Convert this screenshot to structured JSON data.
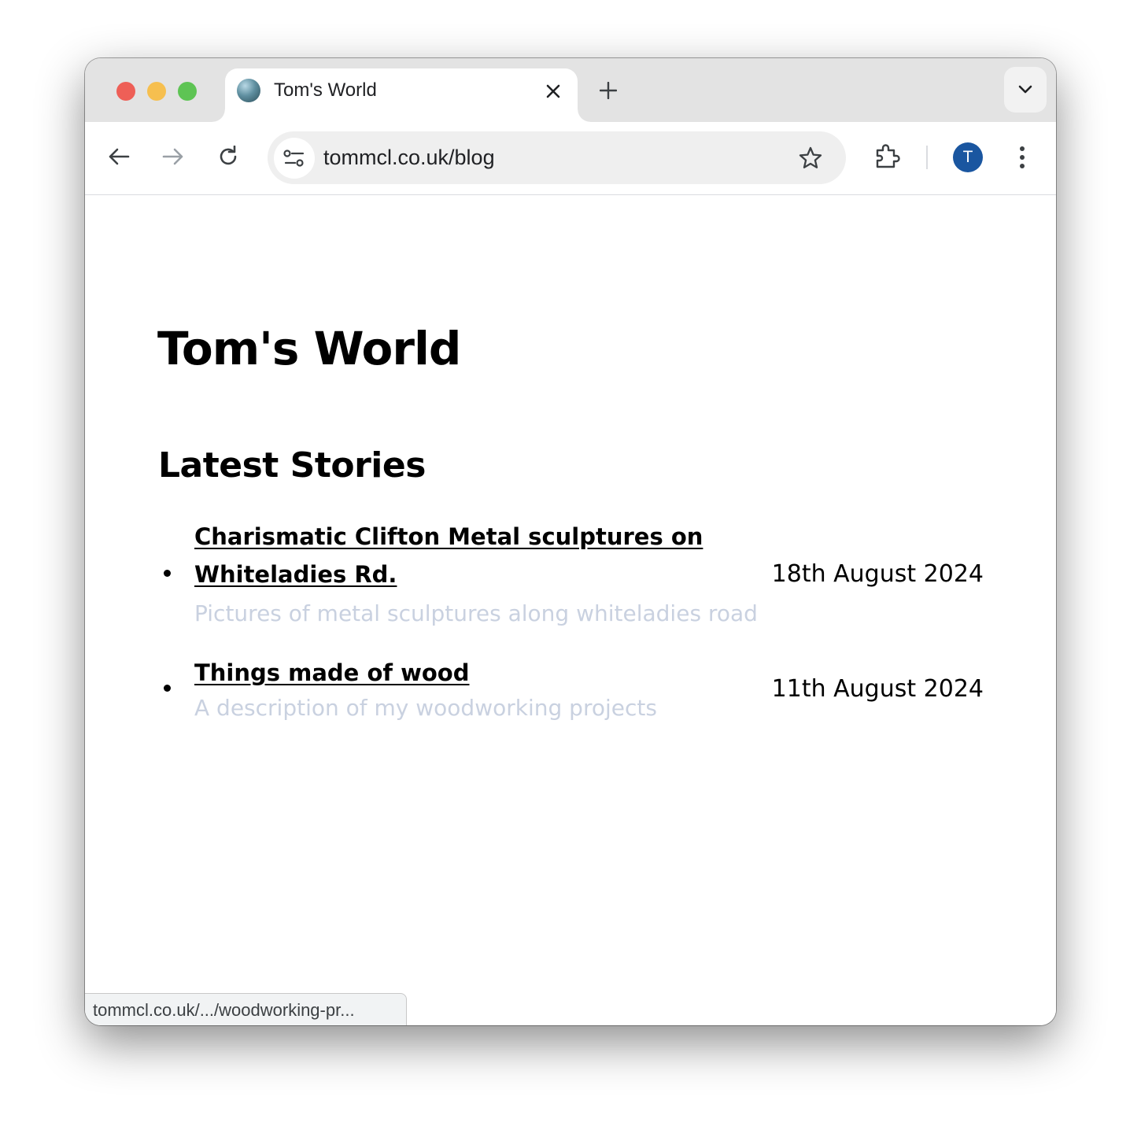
{
  "browser": {
    "tab": {
      "title": "Tom's World"
    },
    "address_bar": {
      "url": "tommcl.co.uk/blog"
    },
    "profile": {
      "initial": "T",
      "color": "#1a56a0"
    },
    "status_bar": {
      "text": "tommcl.co.uk/.../woodworking-pr..."
    }
  },
  "page": {
    "site_title": "Tom's World",
    "section_title": "Latest Stories",
    "stories": [
      {
        "title": "Charismatic Clifton Metal sculptures on Whiteladies Rd.",
        "description": "Pictures of metal sculptures along whiteladies road",
        "date": "18th August 2024"
      },
      {
        "title": "Things made of wood",
        "description": "A description of my woodworking projects",
        "date": "11th August 2024"
      }
    ]
  },
  "icons": {
    "tab_favicon": "globe-favicon-icon",
    "tab_close": "close-icon",
    "new_tab": "plus-icon",
    "tab_search": "chevron-down-icon",
    "back": "arrow-left-icon",
    "forward": "arrow-right-icon",
    "reload": "reload-icon",
    "site_info": "tune-icon",
    "bookmark": "star-icon",
    "extensions": "puzzle-icon",
    "menu": "kebab-menu-icon"
  },
  "colors": {
    "description_text": "#c9d1e0",
    "tabstrip": "#e3e3e3",
    "omnibox": "#efefef"
  }
}
